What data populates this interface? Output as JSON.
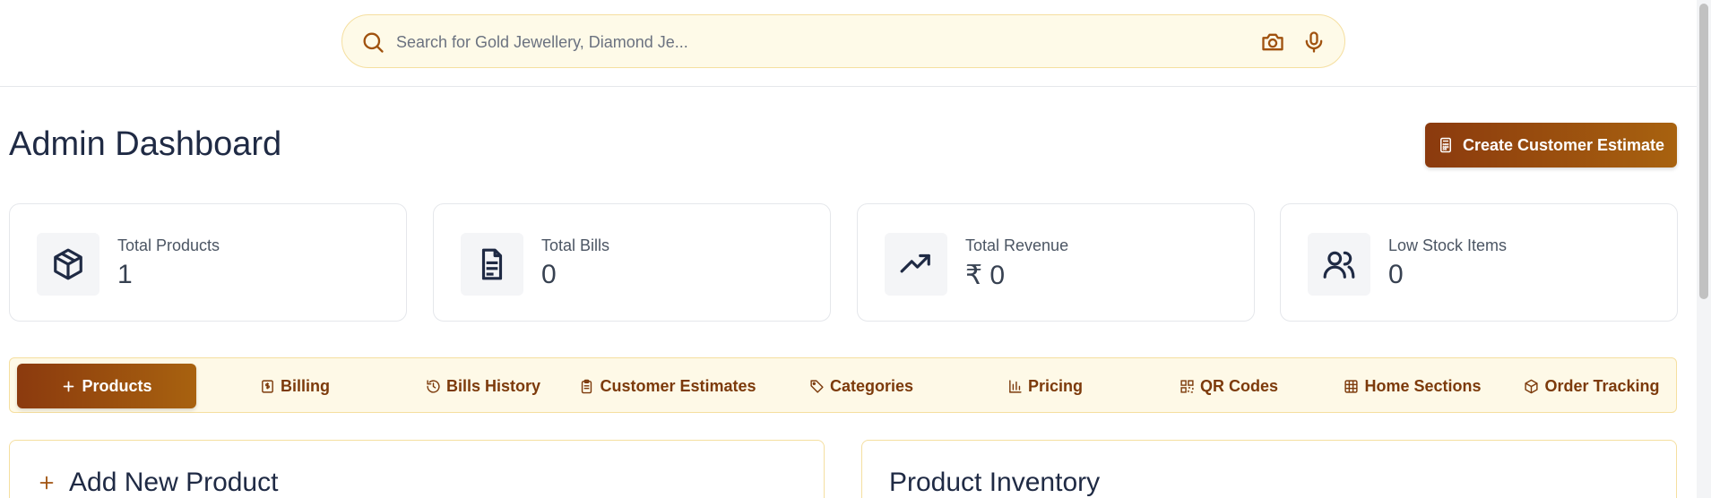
{
  "search": {
    "placeholder": "Search for Gold Jewellery, Diamond Je...",
    "icon": "search-icon",
    "camera_icon": "camera-icon",
    "mic_icon": "microphone-icon"
  },
  "header": {
    "title": "Admin Dashboard",
    "cta_label": "Create Customer Estimate",
    "cta_icon": "calculator-icon"
  },
  "stats": [
    {
      "label": "Total Products",
      "value": "1",
      "icon": "package-icon"
    },
    {
      "label": "Total Bills",
      "value": "0",
      "icon": "file-text-icon"
    },
    {
      "label": "Total Revenue",
      "value": "₹ 0",
      "icon": "trending-up-icon"
    },
    {
      "label": "Low Stock Items",
      "value": "0",
      "icon": "users-icon"
    }
  ],
  "tabs": [
    {
      "label": "Products",
      "icon": "plus-icon",
      "active": true
    },
    {
      "label": "Billing",
      "icon": "receipt-icon"
    },
    {
      "label": "Bills History",
      "icon": "history-icon"
    },
    {
      "label": "Customer Estimates",
      "icon": "clipboard-icon"
    },
    {
      "label": "Categories",
      "icon": "tag-icon"
    },
    {
      "label": "Pricing",
      "icon": "bar-chart-icon"
    },
    {
      "label": "QR Codes",
      "icon": "qr-code-icon"
    },
    {
      "label": "Home Sections",
      "icon": "grid-icon"
    },
    {
      "label": "Order Tracking",
      "icon": "package-icon"
    }
  ],
  "panels": {
    "add_product": {
      "title": "Add New Product",
      "icon": "plus-icon"
    },
    "inventory": {
      "title": "Product Inventory"
    }
  },
  "colors": {
    "accent_start": "#8b3a0e",
    "accent_end": "#a8620f",
    "tab_bar_bg": "#fef9e7",
    "search_bg": "#fefae8"
  }
}
